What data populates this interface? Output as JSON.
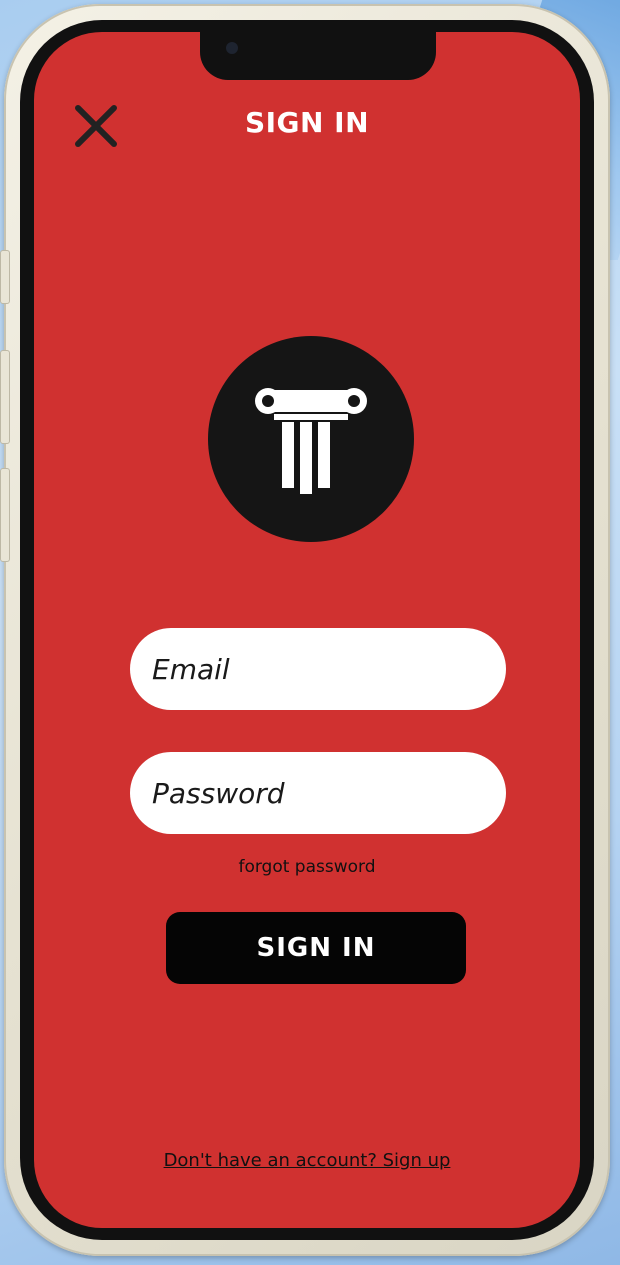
{
  "header": {
    "title": "SIGN IN",
    "close_icon": "close-icon"
  },
  "logo": {
    "icon": "ionic-column-icon"
  },
  "form": {
    "email_placeholder": "Email",
    "email_value": "",
    "password_placeholder": "Password",
    "password_value": "",
    "forgot_label": "forgot password",
    "submit_label": "SIGN IN"
  },
  "footer": {
    "signup_label": "Don't have an account? Sign up"
  },
  "colors": {
    "screen_bg": "#d03130",
    "button_bg": "#050505",
    "field_bg": "#ffffff",
    "logo_bg": "#151515"
  }
}
